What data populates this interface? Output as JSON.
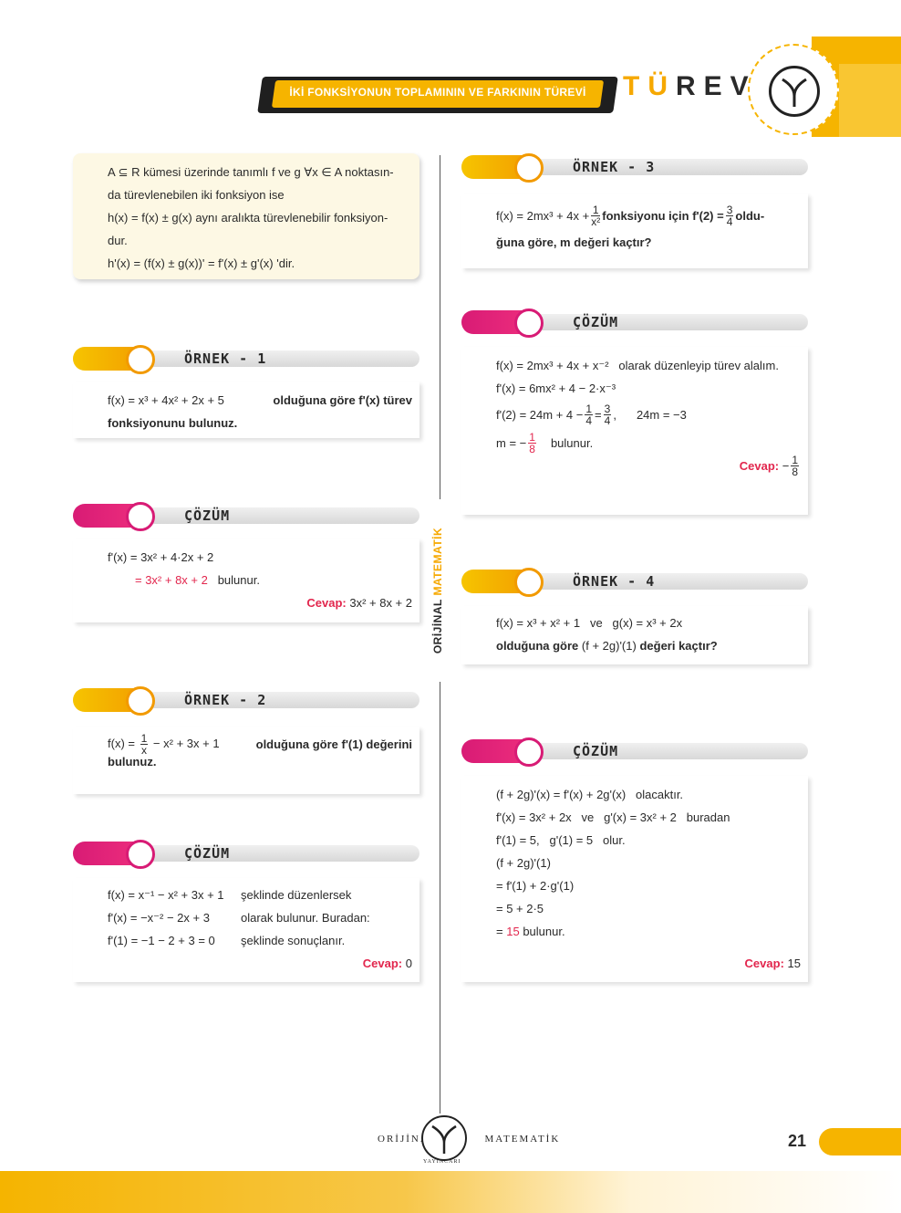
{
  "header": {
    "banner": "İKİ FONKSİYONUN TOPLAMININ VE FARKININ TÜREVİ",
    "title_accent": "TÜ",
    "title_rest": "REV"
  },
  "definition": {
    "line1": "A ⊆ R kümesi üzerinde tanımlı f ve g ∀x ∈ A noktasın-",
    "line2": "da türevlenebilen iki fonksiyon ise",
    "line3": "h(x) = f(x) ± g(x) aynı aralıkta türevlenebilir fonksiyon-",
    "line4": "dur.",
    "line5": "h'(x) = (f(x) ± g(x))' = f'(x) ± g'(x) 'dir."
  },
  "ornek1": {
    "label": "ÖRNEK - 1",
    "q1": "f(x) = x³ + 4x² + 2x + 5",
    "q1b": "olduğuna göre f'(x) türev",
    "q2": "fonksiyonunu bulunuz."
  },
  "cozum1": {
    "label": "ÇÖZÜM",
    "l1": "f'(x) = 3x² + 4·2x + 2",
    "l2a": "= 3x² + 8x + 2",
    "l2b": "bulunur.",
    "cevap_label": "Cevap:",
    "cevap_value": "3x² + 8x + 2"
  },
  "ornek2": {
    "label": "ÖRNEK - 2",
    "q1a": "f(x) =",
    "frac_num": "1",
    "frac_den": "x",
    "q1b": "− x² + 3x + 1",
    "q1c": "olduğuna göre f'(1) değerini",
    "q2": "bulunuz."
  },
  "cozum2": {
    "label": "ÇÖZÜM",
    "rows": [
      {
        "left": "f(x) = x⁻¹ − x² + 3x + 1",
        "right": "şeklinde düzenlersek"
      },
      {
        "left": "f'(x) = −x⁻² − 2x + 3",
        "right": "olarak bulunur. Buradan:"
      },
      {
        "left": "f'(1) = −1 − 2 + 3 = 0",
        "right": "şeklinde sonuçlanır."
      }
    ],
    "cevap_label": "Cevap:",
    "cevap_value": "0"
  },
  "ornek3": {
    "label": "ÖRNEK - 3",
    "q1a": "f(x) = 2mx³ + 4x +",
    "frac1_num": "1",
    "frac1_den": "x²",
    "q1b": "fonksiyonu için f'(2) =",
    "frac2_num": "3",
    "frac2_den": "4",
    "q1c": "oldu-",
    "q2": "ğuna göre, m değeri kaçtır?"
  },
  "cozum3": {
    "label": "ÇÖZÜM",
    "l1a": "f(x) = 2mx³ + 4x + x⁻²",
    "l1b": "olarak düzenleyip türev alalım.",
    "l2": "f'(x) = 6mx² + 4 − 2·x⁻³",
    "l3a": "f'(2) = 24m + 4 −",
    "l3f1n": "1",
    "l3f1d": "4",
    "l3b": "=",
    "l3f2n": "3",
    "l3f2d": "4",
    "l3c": ",",
    "l3d": "24m = −3",
    "l4a": "m = −",
    "l4fn": "1",
    "l4fd": "8",
    "l4b": "bulunur.",
    "cevap_label": "Cevap:",
    "cevap_pre": "−",
    "cevap_num": "1",
    "cevap_den": "8"
  },
  "ornek4": {
    "label": "ÖRNEK - 4",
    "q1a": "f(x) = x³ + x² + 1",
    "q1b": "ve",
    "q1c": "g(x) = x³ + 2x",
    "q2a": "olduğuna göre",
    "q2b": "(f + 2g)'(1)",
    "q2c": "değeri kaçtır?"
  },
  "cozum4": {
    "label": "ÇÖZÜM",
    "l1a": "(f + 2g)'(x) = f'(x) + 2g'(x)",
    "l1b": "olacaktır.",
    "l2a": "f'(x) = 3x² + 2x",
    "l2b": "ve",
    "l2c": "g'(x) = 3x² + 2",
    "l2d": "buradan",
    "l3a": "f'(1) = 5,",
    "l3b": "g'(1) = 5",
    "l3c": "olur.",
    "l4": "(f + 2g)'(1)",
    "l5": "= f'(1) + 2·g'(1)",
    "l6": "= 5 + 2·5",
    "l7a": "=",
    "l7b": "15",
    "l7c": "bulunur.",
    "cevap_label": "Cevap:",
    "cevap_value": "15"
  },
  "side_label_a": "ORİJİNAL ",
  "side_label_b": "MATEMATİK",
  "footer": {
    "logo_left": "ORİJİNAL",
    "logo_right": "MATEMATİK",
    "logo_sub": "YAYINCARI",
    "page_number": "21"
  }
}
